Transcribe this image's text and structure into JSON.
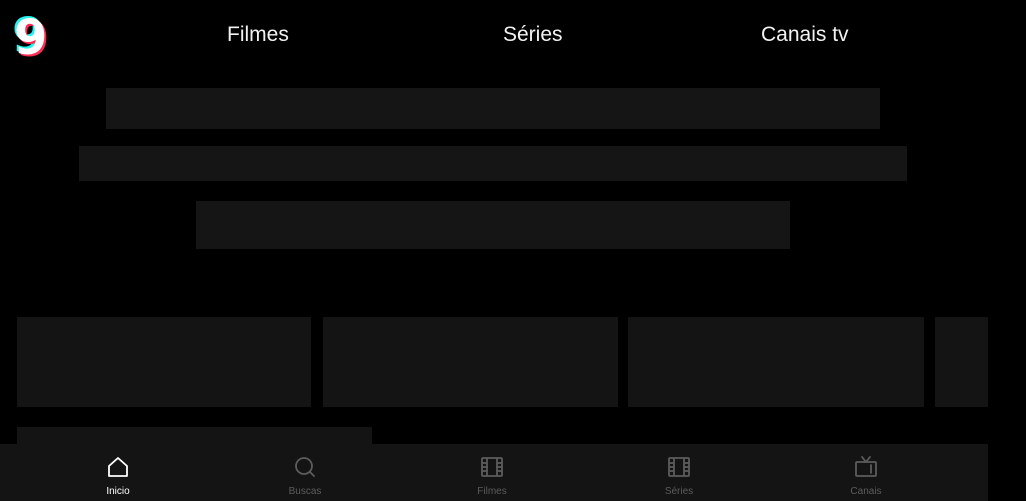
{
  "header": {
    "logo_glyph": "9",
    "logo_colors": {
      "main": "#ffffff",
      "accent_cyan": "#25f4ee",
      "accent_red": "#fe2c55"
    },
    "nav": [
      {
        "label": "Filmes"
      },
      {
        "label": "Séries"
      },
      {
        "label": "Canais tv"
      }
    ]
  },
  "bottom_nav": {
    "active_index": 0,
    "items": [
      {
        "label": "Inicio",
        "icon": "home-icon"
      },
      {
        "label": "Buscas",
        "icon": "search-icon"
      },
      {
        "label": "Filmes",
        "icon": "film-icon"
      },
      {
        "label": "Séries",
        "icon": "film-icon"
      },
      {
        "label": "Canais",
        "icon": "tv-icon"
      }
    ]
  },
  "theme": {
    "background": "#000000",
    "skeleton": "#151515",
    "bar": "#141414",
    "inactive_text": "#5c5c5c"
  }
}
